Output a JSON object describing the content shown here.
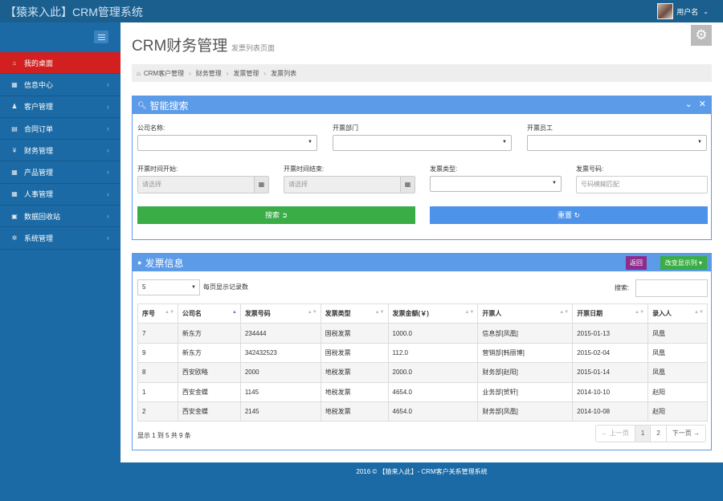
{
  "app": {
    "brand": "【猿来入此】CRM管理系统",
    "user_name": "用户名"
  },
  "sidebar": {
    "items": [
      {
        "label": "我的桌面",
        "icon": "home-icon",
        "glyph": "⌂",
        "active": true
      },
      {
        "label": "信息中心",
        "icon": "calendar-icon",
        "glyph": "▦"
      },
      {
        "label": "客户管理",
        "icon": "user-icon",
        "glyph": "♟"
      },
      {
        "label": "合同订单",
        "icon": "book-icon",
        "glyph": "▤"
      },
      {
        "label": "财务管理",
        "icon": "yen-icon",
        "glyph": "¥"
      },
      {
        "label": "产品管理",
        "icon": "table-icon",
        "glyph": "▦"
      },
      {
        "label": "人事管理",
        "icon": "table-icon",
        "glyph": "▦"
      },
      {
        "label": "数据回收站",
        "icon": "trash-icon",
        "glyph": "▣"
      },
      {
        "label": "系统管理",
        "icon": "gear-icon",
        "glyph": "✲"
      }
    ]
  },
  "page": {
    "title": "CRM财务管理",
    "subtitle": "发票列表页面"
  },
  "breadcrumb": [
    "CRM客户管理",
    "财务管理",
    "发票管理",
    "发票列表"
  ],
  "search_panel": {
    "title": "智能搜索",
    "company_label": "公司名称:",
    "dept_label": "开票部门",
    "employee_label": "开票员工",
    "start_label": "开票时间开始:",
    "start_placeholder": "请选择",
    "end_label": "开票时间结束:",
    "end_placeholder": "请选择",
    "type_label": "发票类型:",
    "number_label": "发票号码:",
    "number_placeholder": "号码模糊匹配",
    "search_button": "搜索 ➲",
    "reset_button": "重置 ↻"
  },
  "results": {
    "title": "发票信息",
    "back_button": "返回",
    "columns_button": "改变显示列 ▾",
    "page_length": "5",
    "page_length_text": "每页显示记录数",
    "search_label": "搜索:",
    "columns": [
      "序号",
      "公司名",
      "发票号码",
      "发票类型",
      "发票金额(￥)",
      "开票人",
      "开票日期",
      "录入人"
    ],
    "rows": [
      [
        "7",
        "新东方",
        "234444",
        "国税发票",
        "1000.0",
        "信息部[凤凰]",
        "2015-01-13",
        "凤凰"
      ],
      [
        "9",
        "新东方",
        "342432523",
        "国税发票",
        "112.0",
        "营销部[韩丽博]",
        "2015-02-04",
        "凤凰"
      ],
      [
        "8",
        "西安欧略",
        "2000",
        "地税发票",
        "2000.0",
        "财务部[赵阳]",
        "2015-01-14",
        "凤凰"
      ],
      [
        "1",
        "西安金蝶",
        "1145",
        "地税发票",
        "4654.0",
        "业务部[贺轩]",
        "2014-10-10",
        "赵阳"
      ],
      [
        "2",
        "西安金蝶",
        "2145",
        "地税发票",
        "4654.0",
        "财务部[凤凰]",
        "2014-10-08",
        "赵阳"
      ]
    ],
    "info": "显示 1 到 5 共 9 条",
    "pager": {
      "prev": "← 上一页",
      "page1": "1",
      "page2": "2",
      "next": "下一页 →"
    }
  },
  "footer": "2016 © 【猿来入此】- CRM客户关系管理系统"
}
